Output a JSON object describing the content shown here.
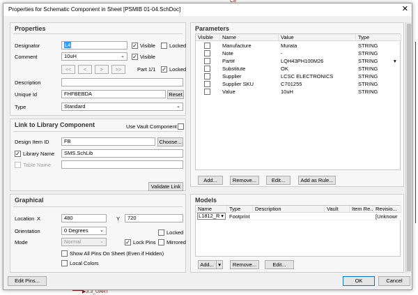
{
  "window": {
    "title": "Properties for Schematic Component in Sheet [PSMIB 01-04.SchDoc]",
    "close": "✕"
  },
  "background": {
    "fragment_top": "C8",
    "fragment_bottom": "3.3_UART"
  },
  "properties": {
    "title": "Properties",
    "designator": {
      "label": "Designator",
      "value": "L4",
      "visible_label": "Visible",
      "visible": true,
      "locked_label": "Locked",
      "locked": false
    },
    "comment": {
      "label": "Comment",
      "value": "10uH",
      "visible_label": "Visible",
      "visible": true
    },
    "nav": [
      "<<",
      "<",
      ">",
      ">>"
    ],
    "part": "Part 1/1",
    "part_locked_label": "Locked",
    "part_locked": true,
    "description": {
      "label": "Description",
      "value": ""
    },
    "unique_id": {
      "label": "Unique Id",
      "value": "FHFBEBDA",
      "reset": "Reset"
    },
    "type": {
      "label": "Type",
      "value": "Standard"
    }
  },
  "link": {
    "title": "Link to Library Component",
    "use_vault_label": "Use Vault Component",
    "use_vault": false,
    "design_item_id": {
      "label": "Design Item ID",
      "value": "FB",
      "choose": "Choose..."
    },
    "library_name": {
      "label": "Library Name",
      "value": "SMS.SchLib",
      "checked": true
    },
    "table_name": {
      "label": "Table Name",
      "value": "",
      "checked": false
    },
    "validate": "Validate Link"
  },
  "graphical": {
    "title": "Graphical",
    "location_label": "Location",
    "x_label": "X",
    "x_value": "480",
    "y_label": "Y",
    "y_value": "720",
    "orientation": {
      "label": "Orientation",
      "value": "0 Degrees",
      "locked_label": "Locked"
    },
    "mode": {
      "label": "Mode",
      "value": "Normal",
      "lock_pins_label": "Lock Pins",
      "lock_pins": true,
      "mirrored_label": "Mirrored"
    },
    "show_all_pins": "Show All Pins On Sheet (Even if Hidden)",
    "local_colors": "Local Colors"
  },
  "parameters": {
    "title": "Parameters",
    "headers": [
      "Visible",
      "Name",
      "Value",
      "Type"
    ],
    "rows": [
      {
        "name": "Manufacture",
        "value": "Murata",
        "type": "STRING"
      },
      {
        "name": "Note",
        "value": "-",
        "type": "STRING"
      },
      {
        "name": "Part#",
        "value": "LQH43PH100M26",
        "type": "STRING"
      },
      {
        "name": "Substitute",
        "value": "OK",
        "type": "STRING"
      },
      {
        "name": "Supplier",
        "value": "LCSC ELECTRONICS",
        "type": "STRING"
      },
      {
        "name": "Supplier SKU",
        "value": "C701255",
        "type": "STRING"
      },
      {
        "name": "Value",
        "value": "10uH",
        "type": "STRING"
      }
    ],
    "buttons": [
      "Add...",
      "Remove...",
      "Edit...",
      "Add as Rule..."
    ]
  },
  "models": {
    "title": "Models",
    "headers": [
      "Name",
      "Type",
      "Description",
      "Vault",
      "Item Re...",
      "Revisio..."
    ],
    "rows": [
      {
        "name": "L1812_R",
        "type": "Footprint",
        "description": "",
        "vault": "",
        "item": "",
        "revision": "[Unknowr"
      }
    ],
    "buttons": [
      "Add...",
      "Remove...",
      "Edit..."
    ]
  },
  "footer": {
    "edit_pins": "Edit Pins...",
    "ok": "OK",
    "cancel": "Cancel"
  }
}
